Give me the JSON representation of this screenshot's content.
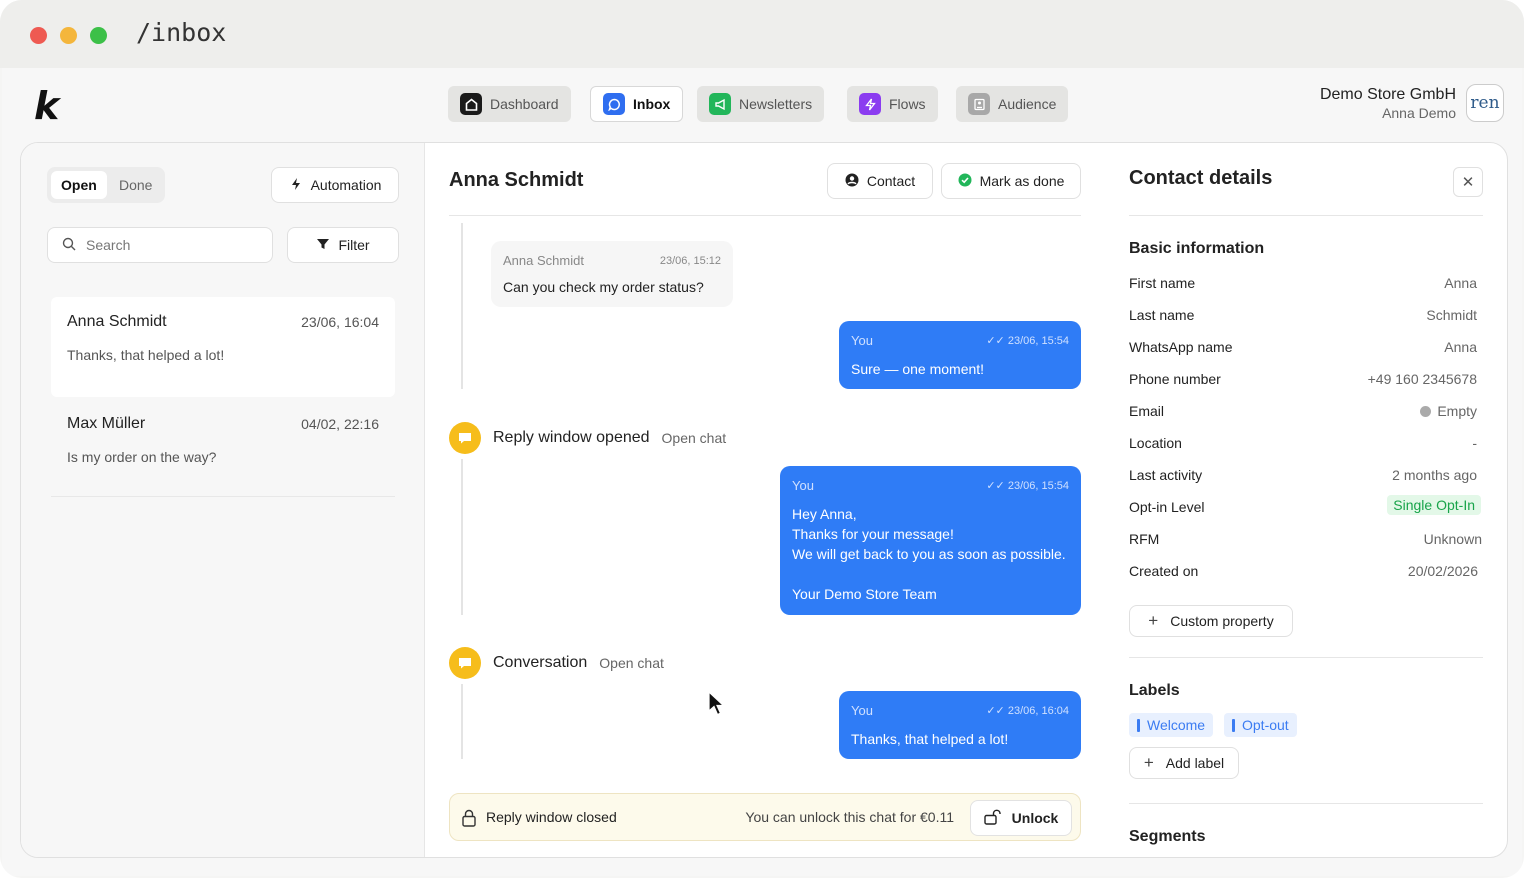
{
  "window": {
    "path": "/inbox"
  },
  "nav": {
    "dashboard": "Dashboard",
    "inbox": "Inbox",
    "newsletters": "Newsletters",
    "flows": "Flows",
    "audience": "Audience"
  },
  "account": {
    "store": "Demo Store GmbH",
    "user": "Anna Demo",
    "avatar_text": "ren"
  },
  "left": {
    "tab_open": "Open",
    "tab_done": "Done",
    "automation": "Automation",
    "search_placeholder": "Search",
    "filter": "Filter",
    "conversations": [
      {
        "name": "Anna Schmidt",
        "time": "23/06, 16:04",
        "preview": "Thanks, that helped a lot!"
      },
      {
        "name": "Max Müller",
        "time": "04/02, 22:16",
        "preview": "Is my order on the way?"
      }
    ]
  },
  "chat": {
    "title": "Anna Schmidt",
    "contact_btn": "Contact",
    "done_btn": "Mark as done",
    "incoming": {
      "who": "Anna Schmidt",
      "when": "23/06, 15:12",
      "text": "Can you check my order status?"
    },
    "msg1": {
      "who": "You",
      "when": "23/06, 15:54",
      "text": "Sure — one moment!"
    },
    "event1": {
      "title": "Reply window opened",
      "sub": "Open chat"
    },
    "msg2": {
      "who": "You",
      "when": "23/06, 15:54",
      "line1": "Hey Anna,",
      "line2": "Thanks for your message!",
      "line3": "We will get back to you as soon as possible.",
      "line4": "Your Demo Store Team"
    },
    "event2": {
      "title": "Conversation",
      "sub": "Open chat"
    },
    "msg3": {
      "who": "You",
      "when": "23/06, 16:04",
      "text": "Thanks, that helped a lot!"
    },
    "closed": {
      "title": "Reply window closed",
      "unlock_text": "You can unlock this chat for €0.11",
      "unlock_btn": "Unlock"
    }
  },
  "contact": {
    "title": "Contact details",
    "basic_heading": "Basic information",
    "fields": [
      {
        "label": "First name",
        "value": "Anna"
      },
      {
        "label": "Last name",
        "value": "Schmidt"
      },
      {
        "label": "WhatsApp name",
        "value": "Anna"
      },
      {
        "label": "Phone number",
        "value": "+49 160 2345678"
      },
      {
        "label": "Email",
        "value": "Empty"
      },
      {
        "label": "Location",
        "value": "-"
      },
      {
        "label": "Last activity",
        "value": "2 months ago"
      },
      {
        "label": "Opt-in Level",
        "value": "Single Opt-In"
      },
      {
        "label": "RFM",
        "value": "Unknown"
      },
      {
        "label": "Created on",
        "value": "20/02/2026"
      }
    ],
    "custom_property": "Custom property",
    "labels_heading": "Labels",
    "labels": [
      "Welcome",
      "Opt-out"
    ],
    "add_label": "Add label",
    "segments_heading": "Segments"
  }
}
